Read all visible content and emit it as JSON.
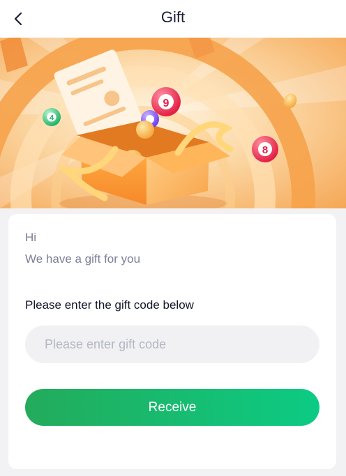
{
  "header": {
    "title": "Gift",
    "back_icon": "chevron-left-icon"
  },
  "banner": {
    "balls": [
      "4",
      "9",
      "8"
    ]
  },
  "card": {
    "greeting": "Hi",
    "message": "We have a gift for you",
    "code_label": "Please enter the gift code below",
    "code_input": {
      "value": "",
      "placeholder": "Please enter gift code"
    },
    "receive_label": "Receive"
  },
  "colors": {
    "accent_start": "#23ab5b",
    "accent_end": "#0ccb84",
    "banner_orange": "#f7a74c"
  }
}
